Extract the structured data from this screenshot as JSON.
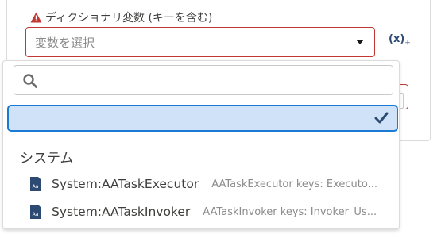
{
  "field": {
    "label": "ディクショナリ変数 (キーを含む)",
    "placeholder": "変数を選択",
    "fx_label": "(x)",
    "fx_sub": "+"
  },
  "search": {
    "value": "",
    "placeholder": ""
  },
  "group": {
    "header": "システム"
  },
  "options": [
    {
      "name": "System:AATaskExecutor",
      "description": "AATaskExecutor keys: Executo..."
    },
    {
      "name": "System:AATaskInvoker",
      "description": "AATaskInvoker keys: Invoker_Us..."
    }
  ],
  "colors": {
    "error_border": "#c23934",
    "warning_icon": "#c23934",
    "selected_bg": "#cfe2f7",
    "selected_border": "#1b7bd4",
    "check": "#2d4a72",
    "var_icon": "#2d4a72"
  },
  "icons": {
    "warning": "warning-icon",
    "caret": "caret-down-icon",
    "fx": "insert-variable-icon",
    "search": "search-icon",
    "check": "check-icon",
    "variable": "dictionary-variable-icon"
  }
}
